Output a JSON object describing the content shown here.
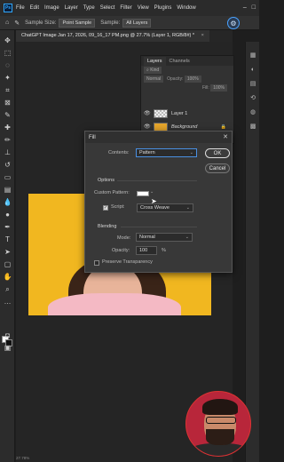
{
  "menubar": {
    "logo": "Ps",
    "items": [
      "File",
      "Edit",
      "Image",
      "Layer",
      "Type",
      "Select",
      "Filter",
      "View",
      "Plugins",
      "Window"
    ]
  },
  "options": {
    "sample_size_label": "Sample Size:",
    "sample_size_value": "Point Sample",
    "sample_label": "Sample:",
    "sample_value": "All Layers"
  },
  "document_tab": {
    "title": "ChatGPT Image Jan 17, 2026, 09_16_17 PM.png @ 27.7% (Layer 1, RGB/8#) *"
  },
  "layers_panel": {
    "tabs": [
      "Layers",
      "Channels"
    ],
    "kind_placeholder": "Kind",
    "blend_mode": "Normal",
    "opacity_label": "Opacity:",
    "opacity_value": "100%",
    "fill_label": "Fill:",
    "fill_value": "100%",
    "layers": [
      {
        "name": "Layer 1",
        "thumb": "transparent"
      },
      {
        "name": "Background",
        "thumb": "image"
      }
    ]
  },
  "dialog": {
    "title": "Fill",
    "contents_label": "Contents:",
    "contents_value": "Pattern",
    "ok_label": "OK",
    "cancel_label": "Cancel",
    "options_title": "Options",
    "custom_pattern_label": "Custom Pattern:",
    "script_label": "Script:",
    "script_checked": true,
    "script_value": "Cross Weave",
    "blending_title": "Blending",
    "mode_label": "Mode:",
    "mode_value": "Normal",
    "opacity_label": "Opacity:",
    "opacity_value": "100",
    "opacity_unit": "%",
    "preserve_label": "Preserve Transparency",
    "preserve_checked": false
  },
  "colors": {
    "accent": "#4aa3ff",
    "photo_bg": "#f1b720"
  },
  "status": {
    "zoom": "27.78%"
  }
}
